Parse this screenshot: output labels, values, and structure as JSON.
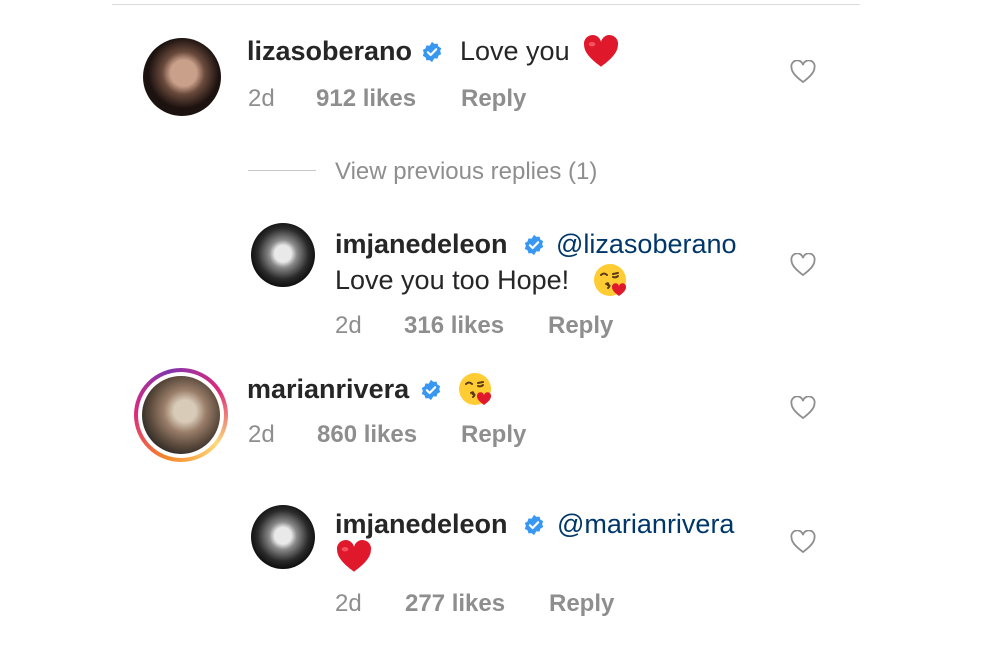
{
  "comments": [
    {
      "username": "lizasoberano",
      "text": "Love you",
      "time": "2d",
      "likes": "912 likes",
      "reply": "Reply",
      "reactions": [
        "red-heart-emoji"
      ]
    },
    {
      "username": "imjanedeleon",
      "mention": "@lizasoberano",
      "text": "Love you too Hope!",
      "time": "2d",
      "likes": "316 likes",
      "reply": "Reply",
      "reactions": [
        "face-blowing-kiss-emoji"
      ]
    },
    {
      "username": "marianrivera",
      "text": "",
      "time": "2d",
      "likes": "860 likes",
      "reply": "Reply",
      "reactions": [
        "face-blowing-kiss-emoji"
      ]
    },
    {
      "username": "imjanedeleon",
      "mention": "@marianrivera",
      "text": "",
      "time": "2d",
      "likes": "277 likes",
      "reply": "Reply",
      "reactions": [
        "red-heart-emoji"
      ]
    }
  ],
  "view_previous": "View previous replies (1)",
  "colors": {
    "verified": "#3897f0",
    "mention": "#00376b",
    "muted": "#8e8e8e",
    "heart": "#ed1c2e",
    "story_ring": [
      "#f58529",
      "#dd2a7b",
      "#8134af"
    ]
  }
}
